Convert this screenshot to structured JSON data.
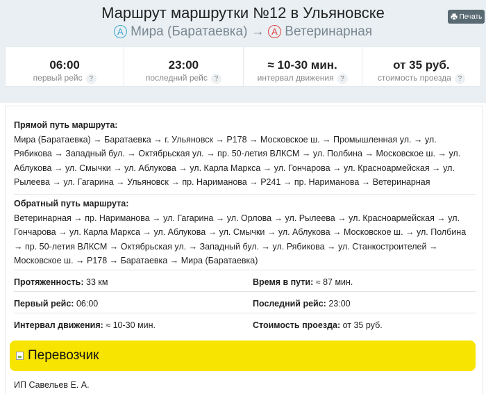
{
  "header": {
    "title": "Маршрут маршрутки №12 в Ульяновске",
    "from_mark": "A",
    "from": "Мира (Баратаевка)",
    "arrow": "→",
    "to_mark": "A",
    "to": "Ветеринарная",
    "print_label": "Печать"
  },
  "stats": [
    {
      "value": "06:00",
      "label": "первый рейс"
    },
    {
      "value": "23:00",
      "label": "последний рейс"
    },
    {
      "value": "≈ 10-30 мин.",
      "label": "интервал движения"
    },
    {
      "value": "от 35 руб.",
      "label": "стоимость проезда"
    }
  ],
  "help_glyph": "?",
  "route": {
    "forward_head": "Прямой путь маршрута:",
    "forward_text": "Мира (Баратаевка) → Баратаевка → г. Ульяновск → Р178 → Московское ш. → Промышленная ул. → ул. Рябикова → Западный бул. → Октябрьская ул. → пр. 50-летия ВЛКСМ → ул. Полбина → Московское ш. → ул. Аблукова → ул. Смычки → ул. Аблукова → ул. Карла Маркса → ул. Гончарова → ул. Красноармейская → ул. Рылеева → ул. Гагарина → Ульяновск → пр. Нариманова → Р241 → пр. Нариманова → Ветеринарная",
    "back_head": "Обратный путь маршрута:",
    "back_text": "Ветеринарная → пр. Нариманова → ул. Гагарина → ул. Орлова → ул. Рылеева → ул. Красноармейская → ул. Гончарова → ул. Карла Маркса → ул. Аблукова → ул. Смычки → ул. Аблукова → Московское ш. → ул. Полбина → пр. 50-летия ВЛКСМ → Октябрьская ул. → Западный бул. → ул. Рябикова → ул. Станкостроителей → Московское ш. → Р178 → Баратаевка → Мира (Баратаевка)"
  },
  "details": {
    "length_label": "Протяженность:",
    "length_value": "33 км",
    "time_label": "Время в пути:",
    "time_value": "≈ 87 мин.",
    "first_label": "Первый рейс:",
    "first_value": "06:00",
    "last_label": "Последний рейс:",
    "last_value": "23:00",
    "interval_label": "Интервал движения:",
    "interval_value": "≈ 10-30 мин.",
    "price_label": "Стоимость проезда:",
    "price_value": "от 35 руб."
  },
  "carrier": {
    "title": "Перевозчик",
    "name": "ИП Савельев Е. А."
  },
  "colors": {
    "header_bg": "#e9eff2",
    "from_mark": "#3aa5cf",
    "to_mark": "#e04040",
    "carrier_bg": "#f7e400",
    "print_btn": "#5a6a73"
  }
}
